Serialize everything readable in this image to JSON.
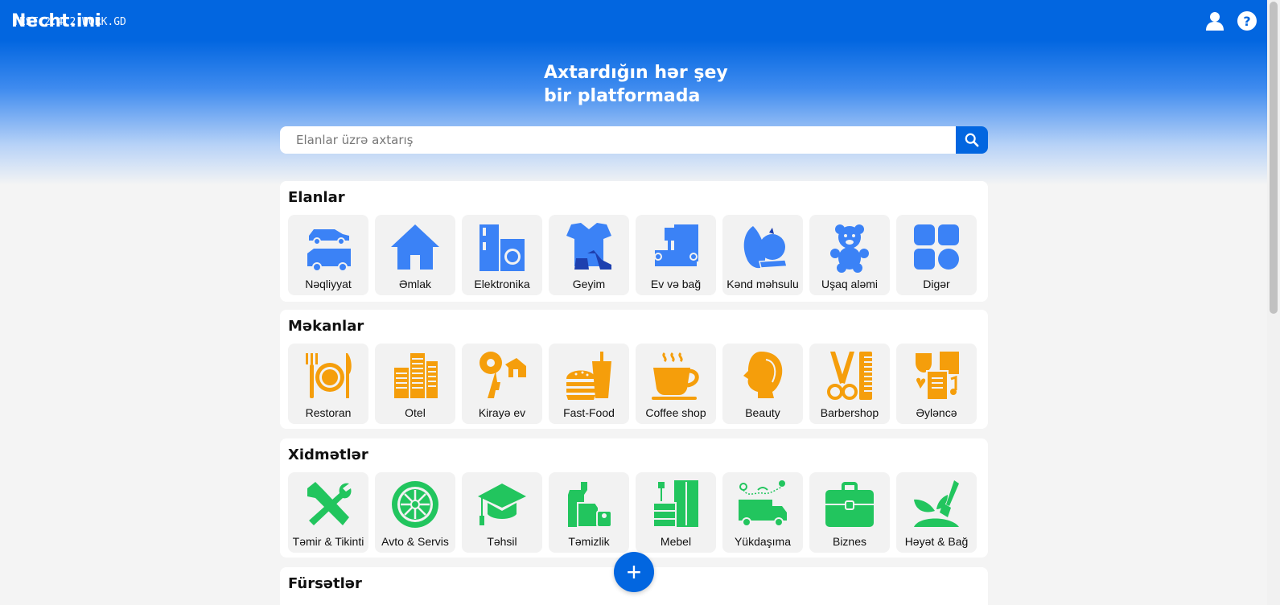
{
  "header": {
    "logo": "Necht.ini",
    "logo_overlay": "TEST.2.4.2 WORK.GD",
    "icons": [
      "user-icon",
      "help-icon"
    ]
  },
  "hero": {
    "headline_line1": "Axtardığın hər şey",
    "headline_line2": "bir platformada"
  },
  "search": {
    "placeholder": "Elanlar üzrə axtarış",
    "icon": "search-icon"
  },
  "colors": {
    "brand": "#0266e0",
    "elanlar": "#3b82f6",
    "mekanlar": "#f59e0b",
    "xidmetler": "#22c55e"
  },
  "sections": [
    {
      "title": "Elanlar",
      "items": [
        {
          "label": "Nəqliyyat",
          "icon": "vehicle-icon"
        },
        {
          "label": "Əmlak",
          "icon": "house-icon"
        },
        {
          "label": "Elektronika",
          "icon": "appliances-icon"
        },
        {
          "label": "Geyim",
          "icon": "clothes-icon"
        },
        {
          "label": "Ev və bağ",
          "icon": "furniture-icon"
        },
        {
          "label": "Kənd məhsulu",
          "icon": "produce-icon"
        },
        {
          "label": "Uşaq aləmi",
          "icon": "teddy-bear-icon"
        },
        {
          "label": "Digər",
          "icon": "grid-icon"
        }
      ]
    },
    {
      "title": "Məkanlar",
      "items": [
        {
          "label": "Restoran",
          "icon": "restaurant-icon"
        },
        {
          "label": "Otel",
          "icon": "hotel-icon"
        },
        {
          "label": "Kirayə ev",
          "icon": "keys-icon"
        },
        {
          "label": "Fast-Food",
          "icon": "burger-icon"
        },
        {
          "label": "Coffee shop",
          "icon": "coffee-cup-icon"
        },
        {
          "label": "Beauty",
          "icon": "woman-head-icon"
        },
        {
          "label": "Barbershop",
          "icon": "scissors-comb-icon"
        },
        {
          "label": "Əyləncə",
          "icon": "entertainment-icon"
        }
      ]
    },
    {
      "title": "Xidmətlər",
      "items": [
        {
          "label": "Təmir & Tikinti",
          "icon": "tools-icon"
        },
        {
          "label": "Avto & Servis",
          "icon": "wheel-icon"
        },
        {
          "label": "Təhsil",
          "icon": "graduation-cap-icon"
        },
        {
          "label": "Təmizlik",
          "icon": "cleaning-icon"
        },
        {
          "label": "Mebel",
          "icon": "cabinet-icon"
        },
        {
          "label": "Yükdaşıma",
          "icon": "truck-icon"
        },
        {
          "label": "Biznes",
          "icon": "briefcase-icon"
        },
        {
          "label": "Həyət & Bağ",
          "icon": "gardening-icon"
        }
      ]
    },
    {
      "title": "Fürsətlər",
      "items": []
    }
  ],
  "fab": {
    "label": "+",
    "icon": "plus-icon"
  }
}
